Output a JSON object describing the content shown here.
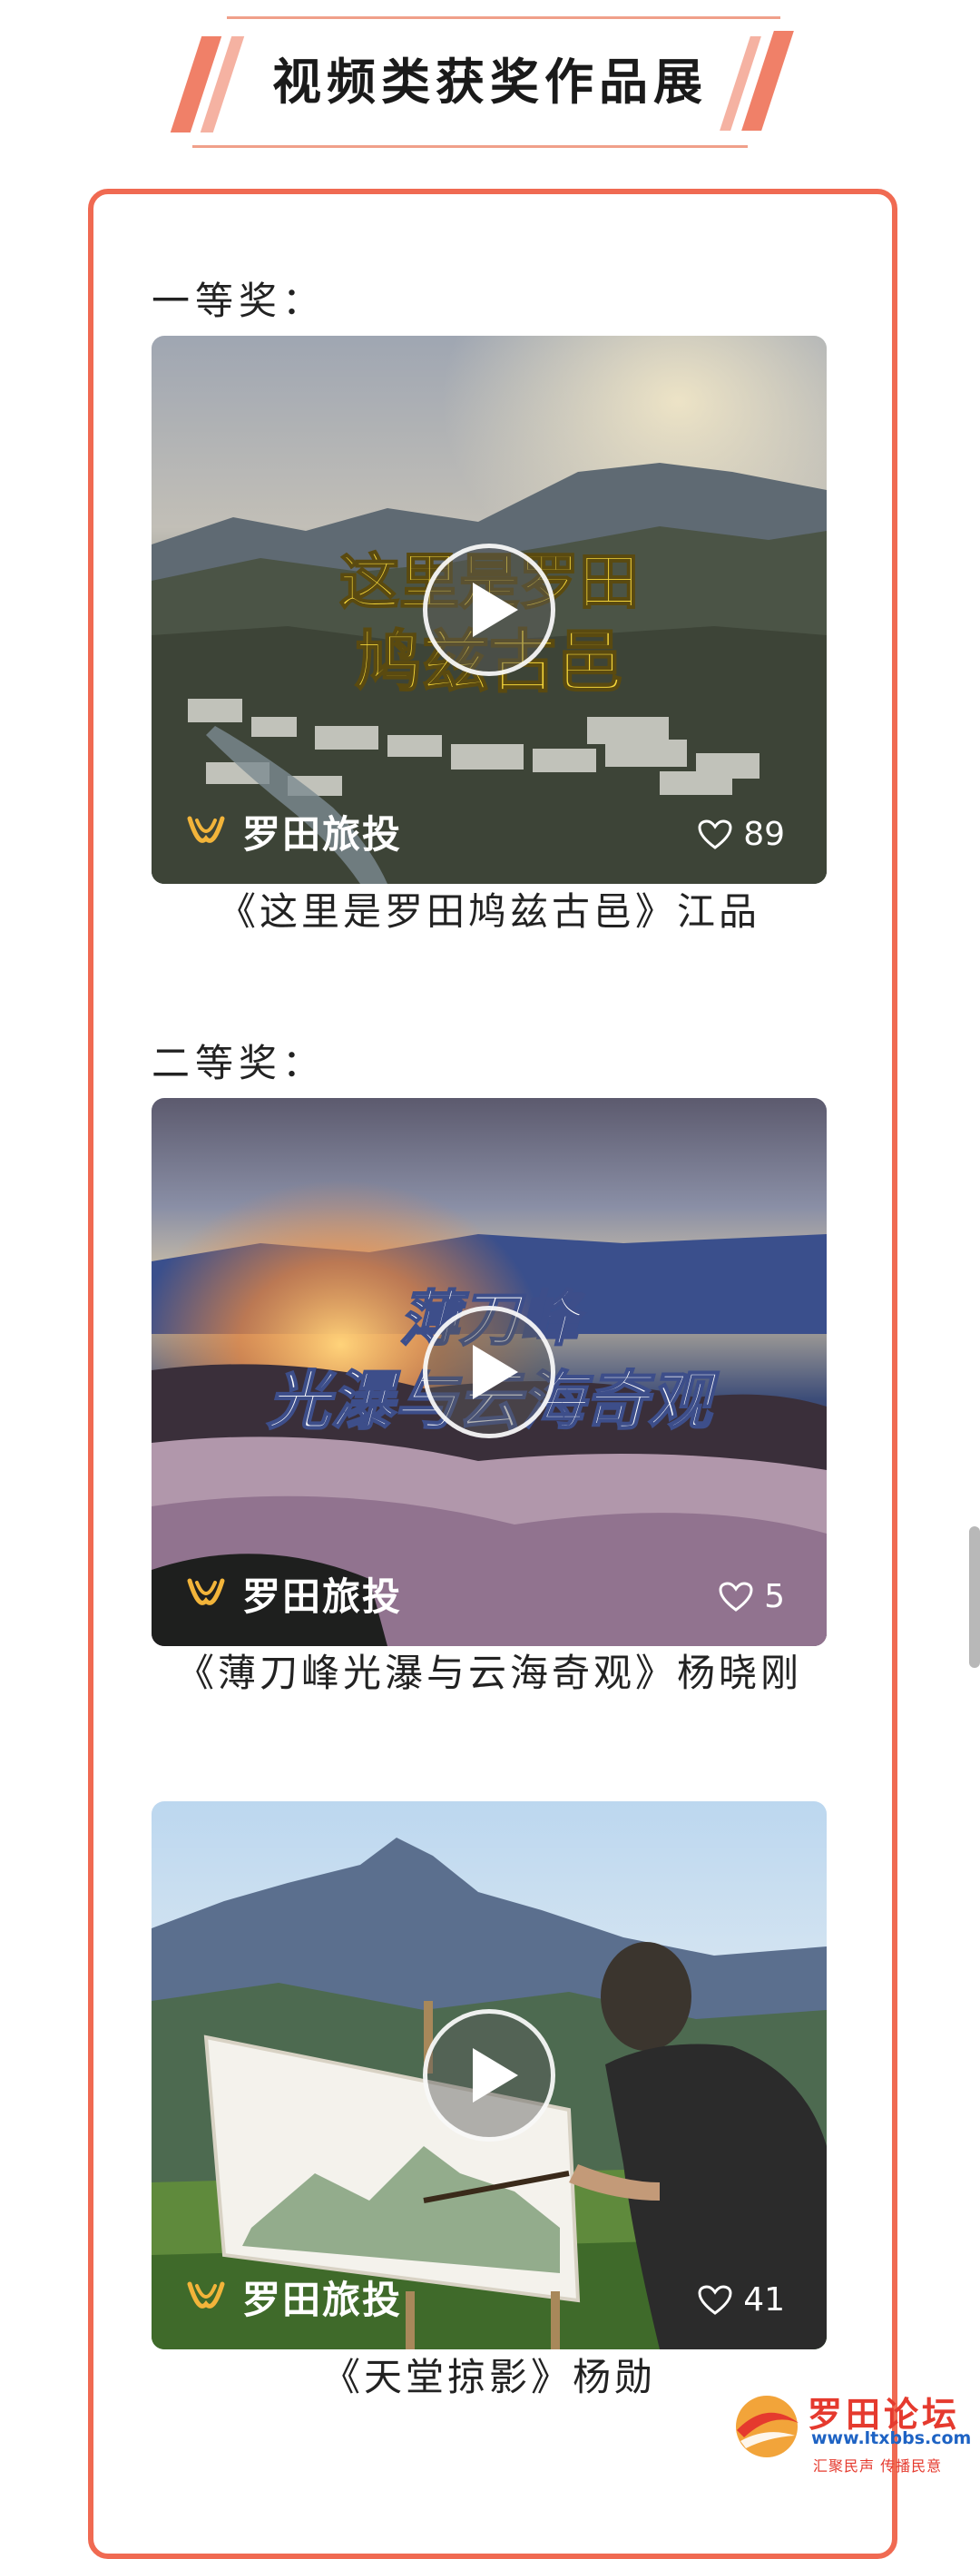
{
  "header": {
    "title": "视频类获奖作品展"
  },
  "colors": {
    "accent": "#f06a52",
    "accent_light": "#f5b2a2"
  },
  "sections": [
    {
      "prize": "一等奖：",
      "video": {
        "overlay_title_line1": "这里是罗田",
        "overlay_title_line2": "鸠兹古邑",
        "brand": "罗田旅投",
        "likes": "89"
      },
      "caption": "《这里是罗田鸠兹古邑》江品"
    },
    {
      "prize": "二等奖：",
      "video": {
        "overlay_title_line1": "薄刀峰",
        "overlay_title_line2": "光瀑与云海奇观",
        "brand": "罗田旅投",
        "likes": "5"
      },
      "caption": "《薄刀峰光瀑与云海奇观》杨晓刚"
    },
    {
      "video": {
        "brand": "罗田旅投",
        "likes": "41"
      },
      "caption": "《天堂掠影》杨勋"
    }
  ],
  "watermark": {
    "name": "罗田论坛",
    "url": "www.ltxbbs.com",
    "slogan": "汇聚民声 传播民意"
  }
}
